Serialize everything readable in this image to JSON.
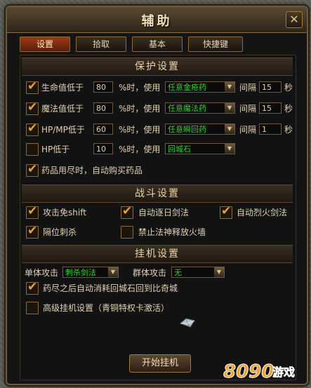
{
  "window": {
    "title": "辅助",
    "close_icon": "close-icon"
  },
  "tabs": [
    {
      "label": "设置",
      "active": true
    },
    {
      "label": "拾取",
      "active": false
    },
    {
      "label": "基本",
      "active": false
    },
    {
      "label": "快捷键",
      "active": false
    }
  ],
  "protect": {
    "header": "保护设置",
    "rows": [
      {
        "checked": true,
        "label": "生命值低于",
        "value": "80",
        "mid": "%时，使用",
        "item": "任意金疮药",
        "interval_label": "间隔",
        "interval": "15",
        "unit": "秒"
      },
      {
        "checked": true,
        "label": "魔法值低于",
        "value": "80",
        "mid": "%时，使用",
        "item": "任意魔法药",
        "interval_label": "间隔",
        "interval": "15",
        "unit": "秒"
      },
      {
        "checked": true,
        "label": "HP/MP低于",
        "value": "60",
        "mid": "%时，使用",
        "item": "任意瞬回药",
        "interval_label": "间隔",
        "interval": "1",
        "unit": "秒"
      },
      {
        "checked": false,
        "label": "HP低于",
        "value": "10",
        "mid": "%时，使用",
        "item": "回城石"
      }
    ],
    "auto_buy": {
      "checked": true,
      "label": "药品用尽时，自动购买药品"
    }
  },
  "combat": {
    "header": "战斗设置",
    "options": [
      {
        "checked": true,
        "label": "攻击免shift"
      },
      {
        "checked": true,
        "label": "自动逐日剑法"
      },
      {
        "checked": true,
        "label": "自动烈火剑法"
      },
      {
        "checked": true,
        "label": "隔位刺杀"
      },
      {
        "checked": false,
        "label": "禁止法神释放火墙"
      }
    ]
  },
  "afk": {
    "header": "挂机设置",
    "single_label": "单体攻击",
    "single_value": "刺杀剑法",
    "group_label": "群体攻击",
    "group_value": "无",
    "return": {
      "checked": true,
      "label": "药尽之后自动消耗回城石回到比奇城"
    },
    "advanced": {
      "checked": false,
      "label": "高级挂机设置（青铜特权卡激活）"
    },
    "start_button": "开始挂机"
  },
  "watermark": {
    "text": "8090游戏"
  },
  "colors": {
    "accent": "#e8a03a",
    "select_text": "#3acb3a",
    "text": "#e0d2b0"
  }
}
